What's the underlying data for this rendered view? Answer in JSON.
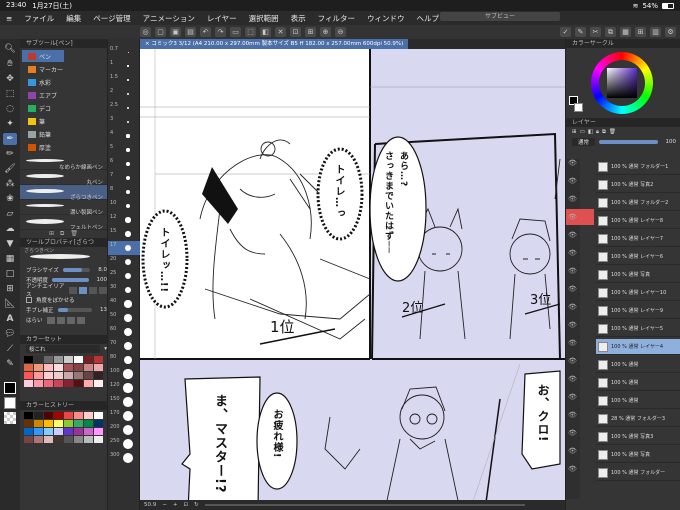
{
  "status": {
    "time": "23:40",
    "date": "1月27日(土)",
    "battery": "54%",
    "wifi": "wifi-icon"
  },
  "menu": {
    "items": [
      "ファイル",
      "編集",
      "ページ管理",
      "アニメーション",
      "レイヤー",
      "選択範囲",
      "表示",
      "フィルター",
      "ウィンドウ",
      "ヘルプ"
    ]
  },
  "subview": {
    "title": "サブビュー"
  },
  "document": {
    "tab": "× コミック3 3/12 (A4 210.00 x 297.00mm 製本サイズ B5 ff 182.00 x 257.00mm 600dpi 50.9%)"
  },
  "left_panel": {
    "subtool_header": "サブツール[ペン]",
    "subtools": [
      "ペン",
      "マーカー",
      "水彩",
      "エアブ",
      "デコ",
      "筆",
      "鉛筆",
      "厚塗",
      "カラー",
      "漫画ペン"
    ],
    "brushes": [
      {
        "label": "なめらか線画ペン"
      },
      {
        "label": "丸ペン"
      },
      {
        "label": "ざらつきペン"
      },
      {
        "label": "濃い製図ペン"
      },
      {
        "label": "フェルトペン"
      }
    ],
    "tool_property_header": "ツールプロパティ[ざらつ",
    "brush_name": "ざらつきペン",
    "brush_size_label": "ブラシサイズ",
    "brush_size_value": "8.0",
    "opacity_label": "不透明度",
    "opacity_value": "100",
    "antialias_label": "アンチエイリアス",
    "angle_label": "角度をぼかせる",
    "correction_label": "手ブレ補正",
    "correction_value": "13",
    "tone_label": "はらい",
    "colorset_header": "カラーセット",
    "colorset_name": "桜これ",
    "history_header": "カラーヒストリー"
  },
  "ruler_values": [
    "0.7",
    "1",
    "1.5",
    "2",
    "2.5",
    "3",
    "4",
    "5",
    "6",
    "7",
    "8",
    "10",
    "12",
    "15",
    "17",
    "20",
    "25",
    "30",
    "40",
    "50",
    "60",
    "70",
    "80",
    "100",
    "120",
    "150",
    "170",
    "200",
    "250",
    "300"
  ],
  "right_panel": {
    "color_circle_header": "カラーサークル",
    "layer_header": "レイヤー",
    "blend_mode": "通常",
    "opacity": "100",
    "layers": [
      {
        "label": "100 % 通常 フォルダー1",
        "selected": false
      },
      {
        "label": "100 % 通常 写真2",
        "selected": false
      },
      {
        "label": "100 % 通常 フォルダー2",
        "selected": false
      },
      {
        "label": "100 % 通常 レイヤー8",
        "selected": false
      },
      {
        "label": "100 % 通常 レイヤー7",
        "selected": false
      },
      {
        "label": "100 % 通常 レイヤー6",
        "selected": false
      },
      {
        "label": "100 % 通常 写真",
        "selected": false
      },
      {
        "label": "100 % 通常 レイヤー10",
        "selected": false
      },
      {
        "label": "100 % 通常 レイヤー9",
        "selected": false
      },
      {
        "label": "100 % 通常 レイヤー5",
        "selected": false
      },
      {
        "label": "100 % 通常 レイヤー4",
        "selected": true
      },
      {
        "label": "100 % 通常",
        "selected": false
      },
      {
        "label": "100 % 通常",
        "selected": false
      },
      {
        "label": "100 % 通常",
        "selected": false
      },
      {
        "label": "28 % 通常 フォルダー3",
        "selected": false
      },
      {
        "label": "100 % 通常 写真3",
        "selected": false
      },
      {
        "label": "100 % 通常 写真",
        "selected": false
      },
      {
        "label": "100 % 通常 フォルダー",
        "selected": false
      }
    ]
  },
  "comic": {
    "bubbles": {
      "toilet1": "トイレ…っ",
      "toilet2": "トイレッ…!!",
      "ara": "あら…?",
      "sakki": "さっきまでいたはず──",
      "maa": "ま、マスター!?",
      "otsukare": "お疲れ様!",
      "oh_kuro": "お、クロ!"
    },
    "ranks": {
      "first": "1位",
      "second": "2位",
      "third": "3位"
    }
  },
  "footer": {
    "zoom": "50.9"
  },
  "colors": {
    "accent": "#4b6fa8",
    "canvas_tint": "#d8d8f0",
    "selected_layer": "#8fb0dc"
  }
}
